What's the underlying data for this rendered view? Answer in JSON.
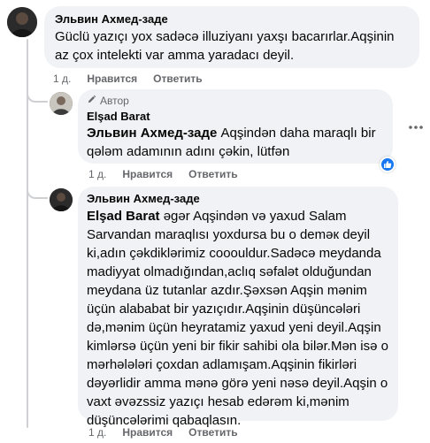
{
  "comments": [
    {
      "author": "Эльвин Ахмед-заде",
      "text_lines": [
        "Güclü yazıçı yox sadəcə illuziyanı yaxşı bacarırlar.Aqşinin",
        "az çox intelekti var amma yaradacı deyil."
      ],
      "time": "1 д.",
      "like_label": "Нравится",
      "reply_label": "Ответить"
    },
    {
      "badge": "Автор",
      "author": "Elşad Barat",
      "mention": "Эльвин Ахмед-заде",
      "text_first_rest": " Aqşindən daha maraqlı bir",
      "text_lines": [
        "qələm adamının adını çəkin, lütfən"
      ],
      "time": "1 д.",
      "like_label": "Нравится",
      "reply_label": "Ответить"
    },
    {
      "author": "Эльвин Ахмед-заде",
      "mention": "Elşad Barat",
      "text_first_rest": " əgər Aqşindən və yaxud Salam",
      "text_lines": [
        "Sarvandan maraqlısı yoxdursa bu o deməк deyil",
        "ki,adın çəkdiklərimiz cooouldur.Sadəcə meydanda",
        "madiyyat olmadığından,aclıq səfalət olduğundan",
        "meydana üz tutanlar azdır.Şəxsən Aqşin mənim",
        "üçün alababat bir yazıçıdır.Aqşinin düşüncələri",
        "də,mənim üçün heyratamiz yaxud yeni deyil.Aqşin",
        "kimlərsə üçün yeni bir fikir sahibi ola bilər.Mən isə o",
        "mərhələləri çoxdan adlamışam.Aqşinin fikirləri",
        "dəyərlidir amma mənə görə yeni nəsə deyil.Aqşin o",
        "vaxt əvəzssiz yazıçı hesab edərəm ki,mənim",
        "düşüncələrimi qabaqlasın."
      ],
      "time": "1 д.",
      "like_label": "Нравится",
      "reply_label": "Ответить"
    }
  ],
  "icons": {
    "more": "more-horizontal-icon",
    "author_badge": "pen-icon",
    "reaction": "like-thumb-icon"
  },
  "colors": {
    "bubble": "#f0f2f5",
    "meta": "#65676b",
    "like_blue": "#1877f2"
  }
}
